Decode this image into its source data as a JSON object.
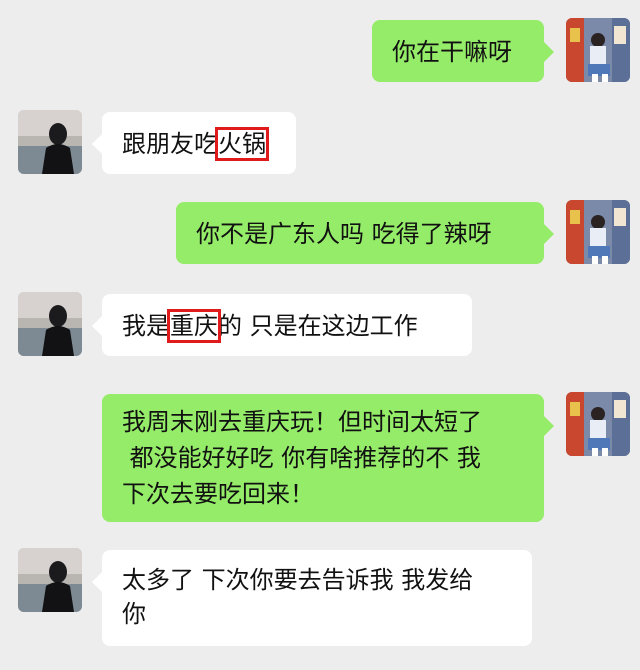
{
  "chat": {
    "messages": [
      {
        "sender": "me",
        "text": "你在干嘛呀"
      },
      {
        "sender": "friend",
        "parts": [
          "跟朋友吃",
          "火锅"
        ],
        "highlight": "火锅"
      },
      {
        "sender": "me",
        "text": "你不是广东人吗 吃得了辣呀"
      },
      {
        "sender": "friend",
        "parts": [
          "我是",
          "重庆",
          "的 只是在这边工作"
        ],
        "highlight": "重庆"
      },
      {
        "sender": "me",
        "lines": [
          "我周末刚去重庆玩！但时间太短了",
          " 都没能好好吃 你有啥推荐的不 我",
          "下次去要吃回来！"
        ]
      },
      {
        "sender": "friend",
        "lines": [
          "太多了 下次你要去告诉我 我发给",
          "你"
        ]
      }
    ]
  },
  "colors": {
    "outgoing_bubble": "#95ec69",
    "incoming_bubble": "#ffffff",
    "background": "#ededed",
    "highlight_box": "#e11b1b"
  }
}
